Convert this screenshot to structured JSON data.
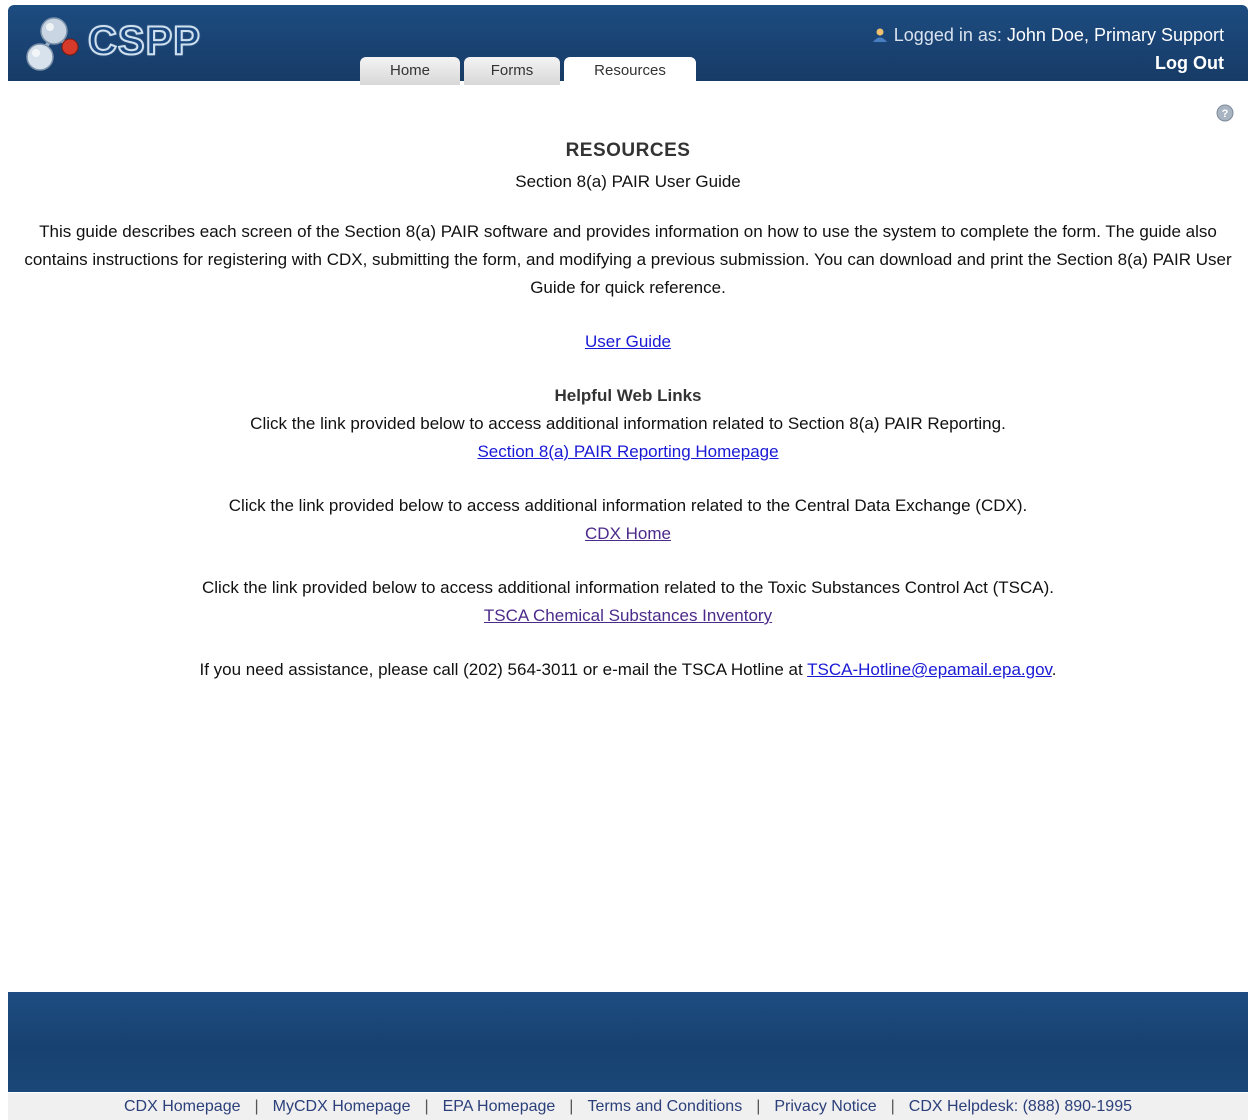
{
  "header": {
    "app_name": "CSPP",
    "tabs": [
      {
        "label": "Home"
      },
      {
        "label": "Forms"
      },
      {
        "label": "Resources"
      }
    ],
    "login_prefix": "Logged in as:",
    "user": "John Doe, Primary Support",
    "logout_label": "Log Out"
  },
  "main": {
    "title": "RESOURCES",
    "subtitle": "Section 8(a) PAIR User Guide",
    "description": "This guide describes each screen of the Section 8(a) PAIR software and provides information on how to use the system to complete the form. The guide also contains instructions for registering with CDX, submitting the form, and modifying a previous submission. You can download and print the Section 8(a) PAIR User Guide for quick reference.",
    "user_guide_link": "User Guide",
    "helpful_heading": "Helpful Web Links",
    "links": [
      {
        "text": "Click the link provided below to access additional information related to Section 8(a) PAIR Reporting.",
        "link": "Section 8(a) PAIR Reporting Homepage"
      },
      {
        "text": "Click the link provided below to access additional information related to the Central Data Exchange (CDX).",
        "link": "CDX Home"
      },
      {
        "text": "Click the link provided below to access additional information related to the Toxic Substances Control Act (TSCA).",
        "link": "TSCA Chemical Substances Inventory"
      }
    ],
    "assist_text": "If you need assistance, please call (202) 564-3011 or e-mail the TSCA Hotline at",
    "assist_email": "TSCA-Hotline@epamail.epa.gov",
    "assist_end": "."
  },
  "footer": {
    "links": [
      "CDX Homepage",
      "MyCDX Homepage",
      "EPA Homepage",
      "Terms and Conditions",
      "Privacy Notice",
      "CDX Helpdesk: (888) 890-1995"
    ],
    "separator": "|"
  },
  "colors": {
    "header_blue": "#1a4475",
    "link_blue": "#1a1ad6",
    "visited_purple": "#4b2a8a"
  },
  "icons": [
    "molecule-logo-icon",
    "user-icon",
    "help-icon"
  ]
}
